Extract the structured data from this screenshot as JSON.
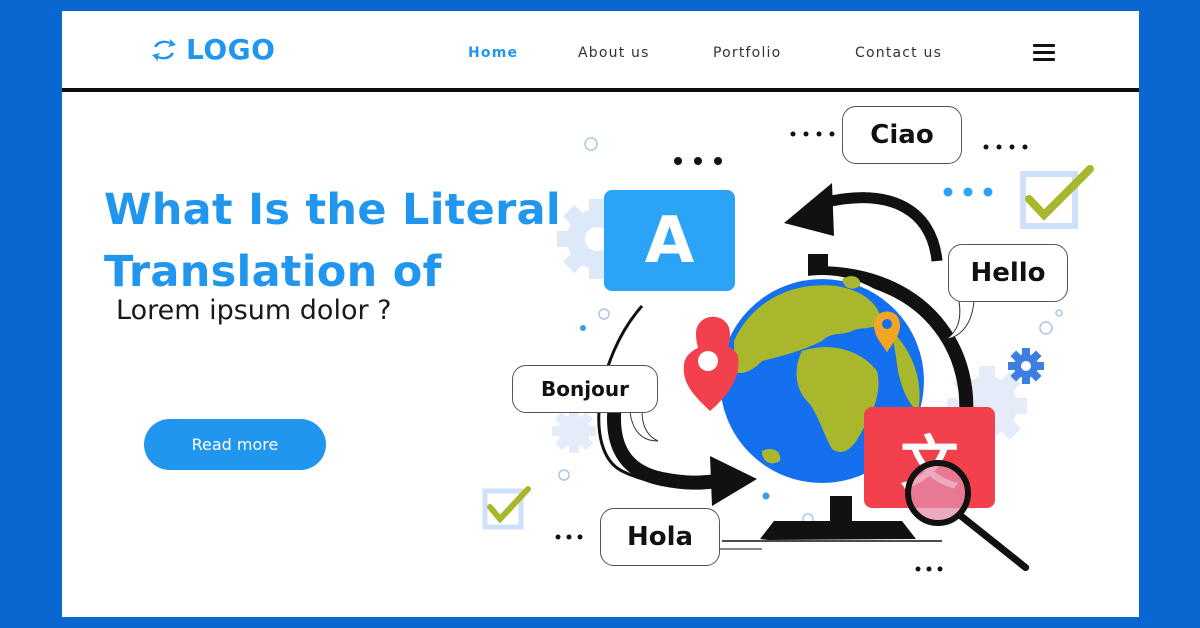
{
  "colors": {
    "frame": "#0a66d0",
    "accent": "#2196ee",
    "ocean": "#1570ef",
    "land": "#a9b72d",
    "pin_red": "#f2404d",
    "pin_orange": "#f5a524",
    "check_green": "#a9b72d"
  },
  "header": {
    "logo_icon": "sync-arrows-icon",
    "logo_text": "LOGO",
    "nav": [
      {
        "label": "Home",
        "active": true
      },
      {
        "label": "About us",
        "active": false
      },
      {
        "label": "Portfolio",
        "active": false
      },
      {
        "label": "Contact us",
        "active": false
      }
    ],
    "menu_icon": "hamburger-menu-icon"
  },
  "hero": {
    "title_line1": "What Is the Literal",
    "title_line2": "Translation of",
    "subtitle": "Lorem ipsum dolor ?",
    "cta_label": "Read more"
  },
  "illustration": {
    "bubbles": {
      "ciao": "Ciao",
      "hello": "Hello",
      "bonjour": "Bonjour",
      "hola": "Hola"
    },
    "latin_card_glyph": "A",
    "chinese_card_glyph": "文",
    "icons": [
      "globe-icon",
      "map-pin-icon",
      "magnifier-icon",
      "gear-icon",
      "checkbox-icon",
      "curved-arrow-icon"
    ]
  }
}
